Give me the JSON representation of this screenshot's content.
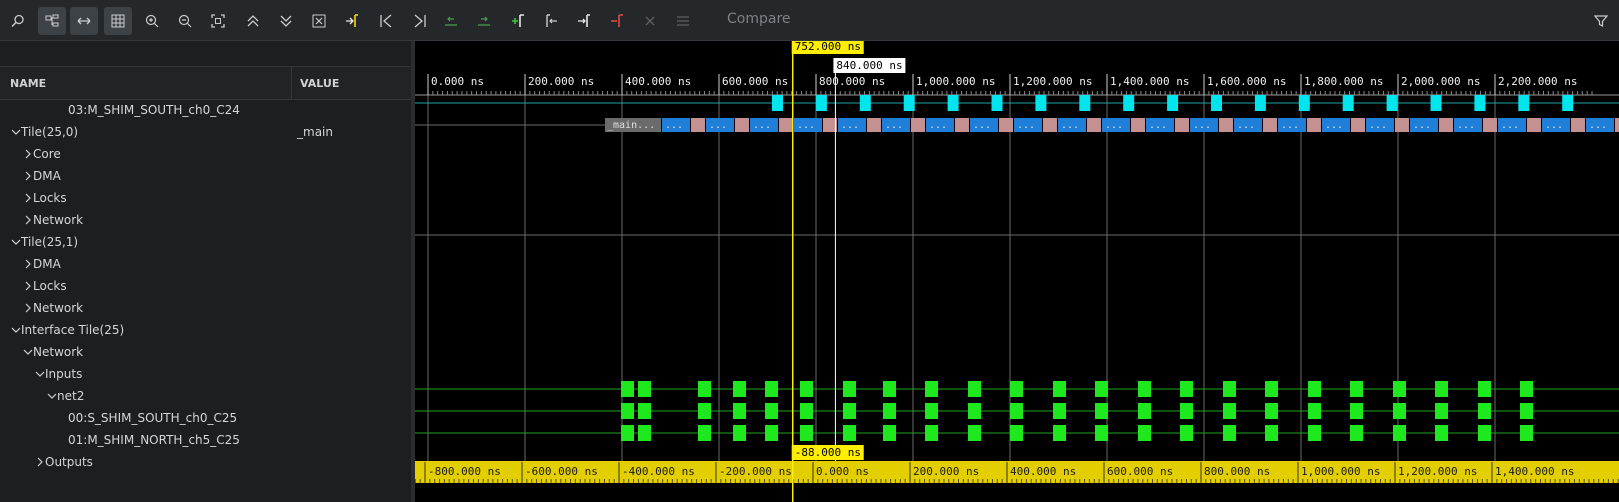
{
  "toolbar": {
    "buttons": [
      {
        "name": "search-icon"
      },
      {
        "name": "hierarchy-icon"
      },
      {
        "name": "fit-width-icon"
      },
      {
        "name": "grid-icon"
      },
      {
        "name": "zoom-in-icon"
      },
      {
        "name": "zoom-out-icon"
      },
      {
        "name": "zoom-fit-icon"
      },
      {
        "name": "collapse-all-icon"
      },
      {
        "name": "expand-all-icon"
      },
      {
        "name": "clear-icon"
      },
      {
        "name": "add-marker-icon"
      },
      {
        "name": "go-first-icon"
      },
      {
        "name": "go-last-icon"
      },
      {
        "name": "prev-edge-icon"
      },
      {
        "name": "next-edge-icon"
      },
      {
        "name": "add-cursor-icon"
      },
      {
        "name": "prev-cursor-icon"
      },
      {
        "name": "next-cursor-icon"
      },
      {
        "name": "remove-cursor-icon"
      },
      {
        "name": "close-icon"
      },
      {
        "name": "menu-icon"
      }
    ],
    "compare_label": "Compare",
    "filter_icon": "filter-icon"
  },
  "columns": {
    "name": "NAME",
    "value": "VALUE"
  },
  "tree": [
    {
      "label": "03:M_SHIM_SOUTH_ch0_C24",
      "value": "",
      "indent": 5,
      "expander": "none"
    },
    {
      "label": "Tile(25,0)",
      "value": "_main",
      "indent": 0,
      "expander": "expanded"
    },
    {
      "label": "Core",
      "value": "",
      "indent": 1,
      "expander": "collapsed"
    },
    {
      "label": "DMA",
      "value": "",
      "indent": 1,
      "expander": "collapsed"
    },
    {
      "label": "Locks",
      "value": "",
      "indent": 1,
      "expander": "collapsed"
    },
    {
      "label": "Network",
      "value": "",
      "indent": 1,
      "expander": "collapsed"
    },
    {
      "label": "Tile(25,1)",
      "value": "",
      "indent": 0,
      "expander": "expanded"
    },
    {
      "label": "DMA",
      "value": "",
      "indent": 1,
      "expander": "collapsed"
    },
    {
      "label": "Locks",
      "value": "",
      "indent": 1,
      "expander": "collapsed"
    },
    {
      "label": "Network",
      "value": "",
      "indent": 1,
      "expander": "collapsed"
    },
    {
      "label": "Interface Tile(25)",
      "value": "",
      "indent": 0,
      "expander": "expanded"
    },
    {
      "label": "Network",
      "value": "",
      "indent": 1,
      "expander": "expanded"
    },
    {
      "label": "Inputs",
      "value": "",
      "indent": 2,
      "expander": "expanded"
    },
    {
      "label": "net2",
      "value": "",
      "indent": 3,
      "expander": "expanded"
    },
    {
      "label": "00:S_SHIM_SOUTH_ch0_C25",
      "value": "",
      "indent": 5,
      "expander": "none"
    },
    {
      "label": "01:M_SHIM_NORTH_ch5_C25",
      "value": "",
      "indent": 5,
      "expander": "none"
    },
    {
      "label": "Outputs",
      "value": "",
      "indent": 2,
      "expander": "collapsed"
    }
  ],
  "waveform": {
    "cursor_label": "752.000 ns",
    "hover_label": "840.000 ns",
    "delta_label": "-88.000 ns",
    "top_ticks": [
      "0.000 ns",
      "200.000 ns",
      "400.000 ns",
      "600.000 ns",
      "800.000 ns",
      "1,000.000 ns",
      "1,200.000 ns",
      "1,400.000 ns",
      "1,600.000 ns",
      "1,800.000 ns",
      "2,000.000 ns",
      "2,200.000 ns"
    ],
    "bottom_ticks": [
      "-800.000 ns",
      "-600.000 ns",
      "-400.000 ns",
      "-200.000 ns",
      "0.000 ns",
      "200.000 ns",
      "400.000 ns",
      "600.000 ns",
      "800.000 ns",
      "1,000.000 ns",
      "1,200.000 ns",
      "1,400.000 ns"
    ],
    "bus_first_label": "_main...",
    "bus_cell_label": "...",
    "colors": {
      "cursor": "#ffee00",
      "timeline_bar": "#e3cf00",
      "cyan_pulse": "#00e5ee",
      "green_pulse": "#1ee81e",
      "bus_blue": "#1f7fd8",
      "bus_pink": "#c49090",
      "bus_gray": "#6b6b6b"
    }
  }
}
